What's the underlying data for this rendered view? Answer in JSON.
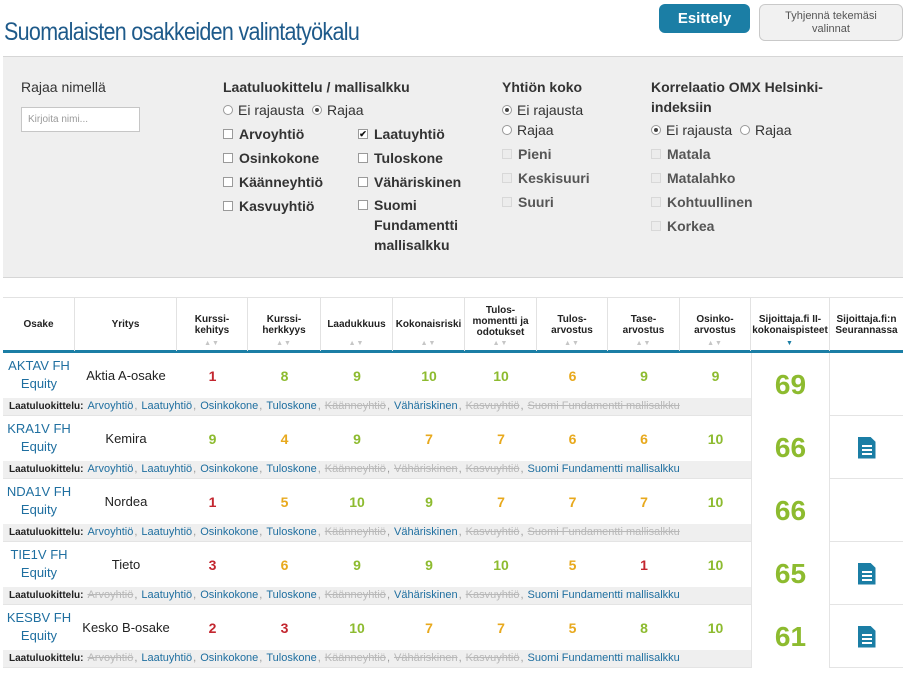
{
  "page": {
    "title": "Suomalaisten osakkeiden valintatyökalu"
  },
  "buttons": {
    "esittely": "Esittely",
    "clear": "Tyhjennä tekemäsi valinnat"
  },
  "filters": {
    "name": {
      "label": "Rajaa nimellä",
      "placeholder": "Kirjoita nimi..."
    },
    "quality": {
      "label": "Laatuluokittelu / mallisalkku",
      "radio": [
        {
          "label": "Ei rajausta",
          "selected": false
        },
        {
          "label": "Rajaa",
          "selected": true
        }
      ],
      "checks": [
        {
          "label": "Arvoyhtiö",
          "checked": false
        },
        {
          "label": "Laatuyhtiö",
          "checked": true
        },
        {
          "label": "Osinkokone",
          "checked": false
        },
        {
          "label": "Tuloskone",
          "checked": false
        },
        {
          "label": "Käänneyhtiö",
          "checked": false
        },
        {
          "label": "Vähäriskinen",
          "checked": false
        },
        {
          "label": "Kasvuyhtiö",
          "checked": false
        },
        {
          "label": "Suomi Fundamentti mallisalkku",
          "checked": false
        }
      ]
    },
    "size": {
      "label": "Yhtiön koko",
      "radio": [
        {
          "label": "Ei rajausta",
          "selected": true
        },
        {
          "label": "Rajaa",
          "selected": false
        }
      ],
      "checks": [
        {
          "label": "Pieni"
        },
        {
          "label": "Keskisuuri"
        },
        {
          "label": "Suuri"
        }
      ]
    },
    "correlation": {
      "label": "Korrelaatio OMX Helsinki-indeksiin",
      "radio": [
        {
          "label": "Ei rajausta",
          "selected": true
        },
        {
          "label": "Rajaa",
          "selected": false
        }
      ],
      "checks": [
        {
          "label": "Matala"
        },
        {
          "label": "Matalahko"
        },
        {
          "label": "Kohtuullinen"
        },
        {
          "label": "Korkea"
        }
      ]
    }
  },
  "table": {
    "headers": {
      "osake": "Osake",
      "yritys": "Yritys",
      "kurssikehitys": "Kurssi-kehitys",
      "kurssiherkkyys": "Kurssi-herkkyys",
      "laadukkuus": "Laadukkuus",
      "kokonaisriski": "Kokonaisriski",
      "tulosmomentti": "Tulos-momentti ja odotukset",
      "tulosarvostus": "Tulos-arvostus",
      "tasearvostus": "Tase-arvostus",
      "osinkoarvostus": "Osinko-arvostus",
      "kokonaispisteet": "Sijoittaja.fi II-kokonaispisteet",
      "seurannassa": "Sijoittaja.fi:n Seurannassa"
    },
    "sort_icon": "▲▼",
    "qual_label": "Laatuluokittelu:",
    "tag_names": [
      "Arvoyhtiö",
      "Laatuyhtiö",
      "Osinkokone",
      "Tuloskone",
      "Käänneyhtiö",
      "Vähäriskinen",
      "Kasvuyhtiö",
      "Suomi Fundamentti mallisalkku"
    ],
    "rows": [
      {
        "ticker_1": "AKTAV FH",
        "ticker_2": "Equity",
        "company": "Aktia A-osake",
        "scores": [
          "1",
          "8",
          "9",
          "10",
          "10",
          "6",
          "9",
          "9"
        ],
        "score_colors": [
          "red",
          "green",
          "green",
          "green",
          "green",
          "yellow",
          "green",
          "green"
        ],
        "total": "69",
        "followed": false,
        "tags_active": [
          true,
          true,
          true,
          true,
          false,
          true,
          false,
          false
        ]
      },
      {
        "ticker_1": "KRA1V FH",
        "ticker_2": "Equity",
        "company": "Kemira",
        "scores": [
          "9",
          "4",
          "9",
          "7",
          "7",
          "6",
          "6",
          "10"
        ],
        "score_colors": [
          "green",
          "yellow",
          "green",
          "yellow",
          "yellow",
          "yellow",
          "yellow",
          "green"
        ],
        "total": "66",
        "followed": true,
        "tags_active": [
          true,
          true,
          true,
          true,
          false,
          false,
          false,
          true
        ]
      },
      {
        "ticker_1": "NDA1V FH",
        "ticker_2": "Equity",
        "company": "Nordea",
        "scores": [
          "1",
          "5",
          "10",
          "9",
          "7",
          "7",
          "7",
          "10"
        ],
        "score_colors": [
          "red",
          "yellow",
          "green",
          "green",
          "yellow",
          "yellow",
          "yellow",
          "green"
        ],
        "total": "66",
        "followed": false,
        "tags_active": [
          true,
          true,
          true,
          true,
          false,
          true,
          false,
          false
        ]
      },
      {
        "ticker_1": "TIE1V FH",
        "ticker_2": "Equity",
        "company": "Tieto",
        "scores": [
          "3",
          "6",
          "9",
          "9",
          "10",
          "5",
          "1",
          "10"
        ],
        "score_colors": [
          "red",
          "yellow",
          "green",
          "green",
          "green",
          "yellow",
          "red",
          "green"
        ],
        "total": "65",
        "followed": true,
        "tags_active": [
          false,
          true,
          true,
          true,
          false,
          true,
          false,
          true
        ]
      },
      {
        "ticker_1": "KESBV FH",
        "ticker_2": "Equity",
        "company": "Kesko B-osake",
        "scores": [
          "2",
          "3",
          "10",
          "7",
          "7",
          "5",
          "8",
          "10"
        ],
        "score_colors": [
          "red",
          "red",
          "green",
          "yellow",
          "yellow",
          "yellow",
          "green",
          "green"
        ],
        "total": "61",
        "followed": true,
        "tags_active": [
          false,
          true,
          true,
          true,
          false,
          false,
          false,
          true
        ]
      }
    ]
  },
  "colors": {
    "accent": "#1b7ea5",
    "title": "#1e5a8a",
    "red": "#c3262f",
    "yellow": "#e8a91d",
    "green": "#8dbb2f"
  },
  "icons": {
    "follow": "document-icon"
  }
}
